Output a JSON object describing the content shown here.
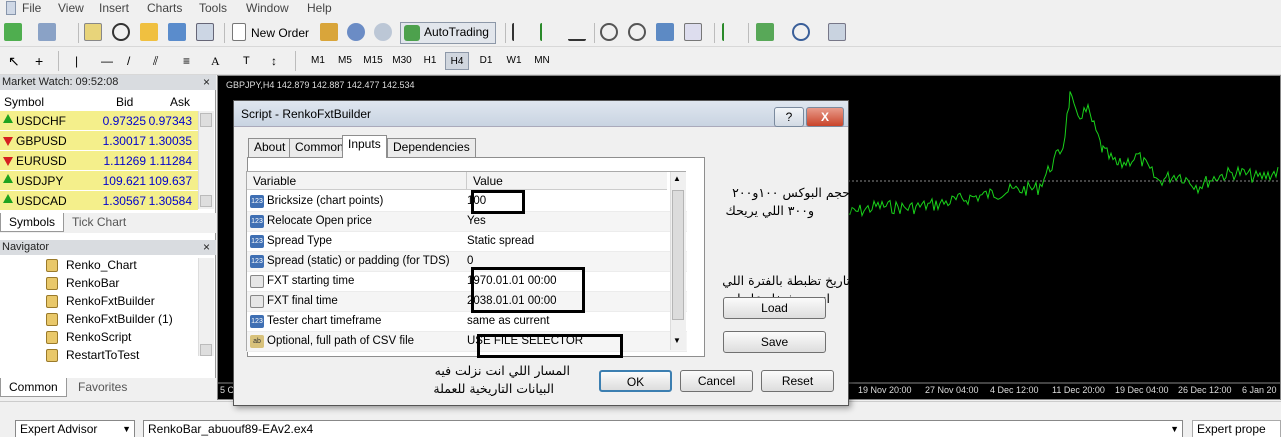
{
  "menu": [
    "File",
    "View",
    "Insert",
    "Charts",
    "Tools",
    "Window",
    "Help"
  ],
  "toolbar": {
    "new_order": "New Order",
    "autotrading": "AutoTrading"
  },
  "timeframes": [
    "M1",
    "M5",
    "M15",
    "M30",
    "H1",
    "H4",
    "D1",
    "W1",
    "MN"
  ],
  "active_timeframe": "H4",
  "market_watch": {
    "title": "Market Watch: 09:52:08",
    "close": "×",
    "headers": {
      "symbol": "Symbol",
      "bid": "Bid",
      "ask": "Ask"
    },
    "rows": [
      {
        "symbol": "USDCHF",
        "bid": "0.97325",
        "ask": "0.97343",
        "dir": "up"
      },
      {
        "symbol": "GBPUSD",
        "bid": "1.30017",
        "ask": "1.30035",
        "dir": "down"
      },
      {
        "symbol": "EURUSD",
        "bid": "1.11269",
        "ask": "1.11284",
        "dir": "down"
      },
      {
        "symbol": "USDJPY",
        "bid": "109.621",
        "ask": "109.637",
        "dir": "up"
      },
      {
        "symbol": "USDCAD",
        "bid": "1.30567",
        "ask": "1.30584",
        "dir": "up"
      }
    ],
    "tabs": [
      "Symbols",
      "Tick Chart"
    ]
  },
  "navigator": {
    "title": "Navigator",
    "close": "×",
    "items": [
      "Renko_Chart",
      "RenkoBar",
      "RenkoFxtBuilder",
      "RenkoFxtBuilder (1)",
      "RenkoScript",
      "RestartToTest"
    ],
    "tabs": [
      "Common",
      "Favorites"
    ]
  },
  "chart": {
    "header": "GBPJPY,H4  142.879 142.887 142.477 142.534",
    "time_labels": [
      "19 Nov 20:00",
      "27 Nov 04:00",
      "4 Dec 12:00",
      "11 Dec 20:00",
      "19 Dec 04:00",
      "26 Dec 12:00",
      "6 Jan 20"
    ],
    "left_label": "5 C",
    "colors": {
      "background": "#000000",
      "line": "#19d11a",
      "grid": "#8a8a8a"
    }
  },
  "status": {
    "combo": "Expert Advisor",
    "file": "RenkoBar_abuouf89-EAv2.ex4",
    "right": "Expert prope"
  },
  "dialog": {
    "title": "Script - RenkoFxtBuilder",
    "help_btn": "?",
    "close_btn": "X",
    "tabs": [
      "About",
      "Common",
      "Inputs",
      "Dependencies"
    ],
    "active_tab": "Inputs",
    "headers": {
      "variable": "Variable",
      "value": "Value"
    },
    "rows": [
      {
        "icon": "123",
        "name": "Bricksize (chart points)",
        "value": "100"
      },
      {
        "icon": "123",
        "name": "Relocate Open price",
        "value": "Yes"
      },
      {
        "icon": "123",
        "name": "Spread Type",
        "value": "Static spread"
      },
      {
        "icon": "123",
        "name": "Spread (static) or padding (for TDS)",
        "value": "0"
      },
      {
        "icon": "date",
        "name": "FXT starting time",
        "value": "1970.01.01 00:00"
      },
      {
        "icon": "date",
        "name": "FXT final time",
        "value": "2038.01.01 00:00"
      },
      {
        "icon": "123",
        "name": "Tester chart timeframe",
        "value": "same as current"
      },
      {
        "icon": "ab",
        "name": "Optional, full path of CSV file",
        "value": "USE FILE SELECTOR"
      }
    ],
    "buttons": {
      "load": "Load",
      "save": "Save",
      "ok": "OK",
      "cancel": "Cancel",
      "reset": "Reset"
    },
    "annotations": {
      "bricksize_1": "حجم البوكس ١٠٠و٢٠٠",
      "bricksize_2": "و٣٠٠ اللي يريحك",
      "dates_1": "تاريخ تظبطة بالفترة اللي",
      "dates_2": "انت هتشتغل عليها",
      "path_1": "المسار اللي انت نزلت فيه",
      "path_2": "البيانات التاريخية للعملة"
    }
  }
}
